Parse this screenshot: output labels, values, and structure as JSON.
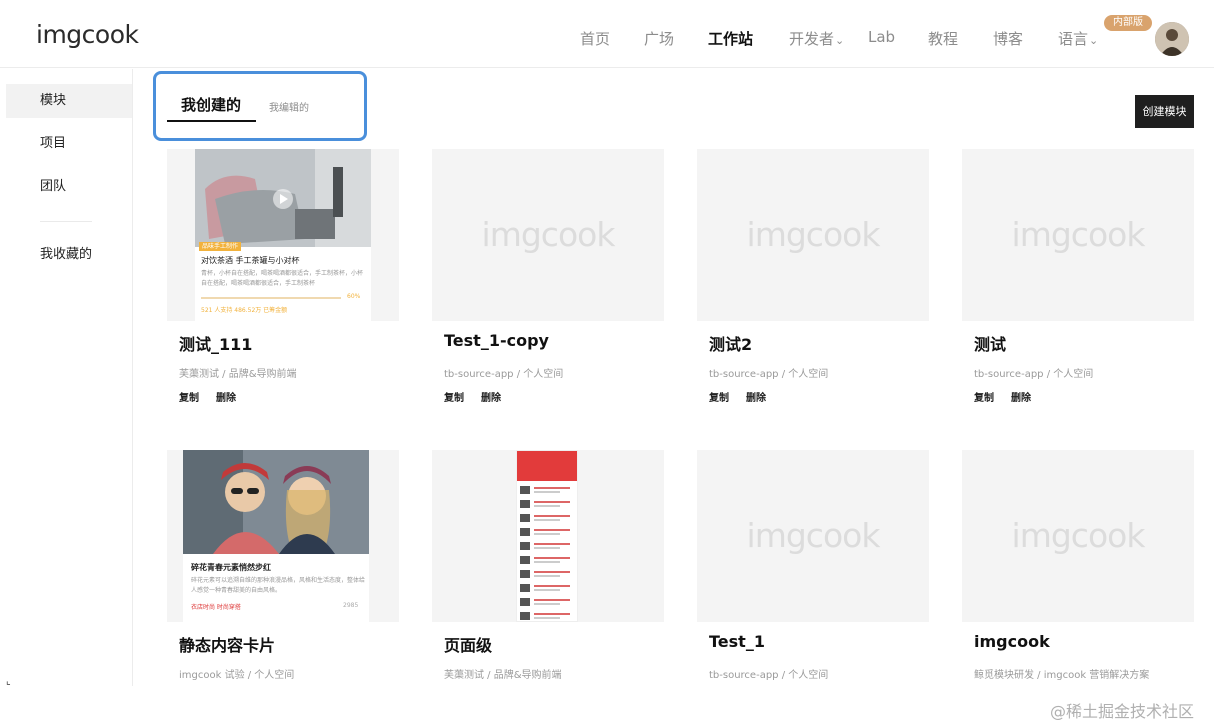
{
  "header": {
    "logo": "imgcook",
    "nav": [
      {
        "label": "首页",
        "name": "nav-home"
      },
      {
        "label": "广场",
        "name": "nav-square"
      },
      {
        "label": "工作站",
        "name": "nav-workstation"
      },
      {
        "label": "开发者",
        "name": "nav-developer"
      },
      {
        "label": "Lab",
        "name": "nav-lab"
      },
      {
        "label": "教程",
        "name": "nav-tutorial"
      },
      {
        "label": "博客",
        "name": "nav-blog"
      },
      {
        "label": "语言",
        "name": "nav-language"
      }
    ],
    "active_nav": "工作站",
    "badge": "内部版",
    "avatar_icon": "user-avatar-icon"
  },
  "sidebar": {
    "items": [
      {
        "label": "模块"
      },
      {
        "label": "项目"
      },
      {
        "label": "团队"
      },
      {
        "label": "我收藏的"
      }
    ],
    "active": "模块"
  },
  "tabs": {
    "items": [
      {
        "label": "我创建的"
      },
      {
        "label": "我编辑的"
      }
    ],
    "active": "我创建的"
  },
  "create_button": "创建模块",
  "actions": {
    "copy": "复制",
    "delete": "删除"
  },
  "placeholder_logo": "imgcook",
  "cards": [
    {
      "title": "测试_111",
      "subtitle": "芙蕖测试 / 品牌&导购前端",
      "preview": "preview-chair"
    },
    {
      "title": "Test_1-copy",
      "subtitle": "tb-source-app / 个人空间",
      "preview": "placeholder"
    },
    {
      "title": "测试2",
      "subtitle": "tb-source-app / 个人空间",
      "preview": "placeholder"
    },
    {
      "title": "测试",
      "subtitle": "tb-source-app / 个人空间",
      "preview": "placeholder"
    },
    {
      "title": "静态内容卡片",
      "subtitle": "imgcook 试验 / 个人空间",
      "preview": "preview-girls"
    },
    {
      "title": "页面级",
      "subtitle": "芙蕖测试 / 品牌&导购前端",
      "preview": "preview-list"
    },
    {
      "title": "Test_1",
      "subtitle": "tb-source-app / 个人空间",
      "preview": "placeholder"
    },
    {
      "title": "imgcook",
      "subtitle": "鲸觅模块研发 / imgcook 营销解决方案",
      "preview": "placeholder"
    }
  ],
  "preview_chair": {
    "tag": "品味手工制作",
    "title": "对饮茶酒 手工茶罐与小对杯",
    "desc": "青杯，小杯自在搭配，喝茶喝酒都很适合，手工制茶杯，小杯自在搭配，喝茶喝酒都很适合，手工制茶杯",
    "percent": "60%",
    "meta": "521 人支持    486.52万 已筹金额"
  },
  "preview_girls": {
    "title": "碎花青春元素悄然步红",
    "desc": "碎花元素可以追溯自维的那种浪漫品格，风格和生活态度，整体给人感觉一种青春甜美的自由风格。",
    "shop": "衣店时尚  时尚穿搭",
    "count": "2985"
  },
  "watermark": "@稀土掘金技术社区",
  "colors": {
    "accent": "#4a8fdb",
    "badge": "#d9a36d",
    "button_bg": "#1f1f1f"
  }
}
